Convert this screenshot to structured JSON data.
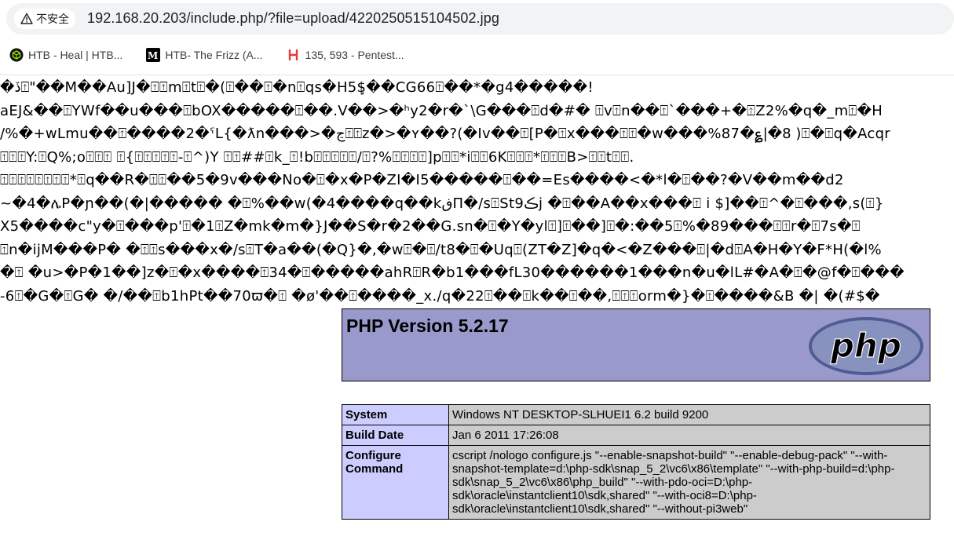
{
  "browser": {
    "security_label": "不安全",
    "url": "192.168.20.203/include.php/?file=upload/4220250515104502.jpg",
    "bookmarks": [
      {
        "label": "HTB - Heal | HTB..."
      },
      {
        "label": "HTB- The Frizz (A..."
      },
      {
        "label": "135, 593 - Pentest..."
      }
    ]
  },
  "garbage_lines": [
    "�ڏ⍐\"��M��Au]J�⍐⍐m⍐t⍐�(⍐��⍐�n⍐qs�H5$̧��CG66⍐��*�g4�����!",
    "aEJ&��⍐YWf��u���⍐bOX�����⍐��.V��>�ʰy2�r�`\\G���⍐d�#� ⍐v⍐n��⍐`���+�⍐Z2%�q�_m⍐�H",
    "/%�+wLmu��⍐����2�ˁL{�ƛn���>�ڃ⍐⍐z�>�ʏ��?(�Iv��⍐[P�⍐x���⍐⍐�w���%87�؏|�8 )⍐�⍐q�Acqr",
    "⍐⍐⍐Y:⍐Q%;o⍐⍐⍐ ⍐{⍐⍐⍐⍐⍐-⍐^)Y ⍐⍐##⍐k_⍐!b⍐⍐⍐⍐⍐/⍐?%⍐⍐⍐⍐]p⍐⍐*i⍐⍐6K⍐⍐⍐*⍐⍐⍐B>⍐⍐t⍐⍐.",
    "⍐⍐⍐⍐⍐⍐⍐⍐*⍐q��R�⍐⍐��5�9v���No�⍐�x�P�ZI�I5�����⍐��=Es����<�*l�⍐��?�V��m��d2",
    "~�4�ሌP�ɲ��(�|����� �⍐%��w(�4����q��kڧΠ�/s⍐St9ڪj �⍐��A��x���⍐ i $]��⍐^�⍐���,s(⍐}",
    "X5����c\"y�⍐���p'⍐�1⍐Z�mk�m�}J��S�r�2��G.sn�⍐�Y�yl⍐]⍐��]⍐�:��5⍐%�89���⍐⍐r�⍐7s�⍐",
    "⍐n�ijM���P� �⍐⍐s���x�/s⍐T�a��(�Q}�,�w⍐�⍐/t8�⍐�Uq⍐(ZT�Z]�q�<�Z���⍐|�d⍐A�H�Y�F*H(�l%",
    "�⍐ �u>�P�1��]z�⍐�x����⍐34�⍐�����ahR⍐R�b1���fL30������1���n�u�lL#�A�⍐�@f�⍐���",
    "-6⍐�G�⍐G� �/��⍐b1hPt��70ϖ�⍐ �ø'��⍐����_x./q�22⍐��⍐k��⍐��,⍐⍐⍐orm�}�⍐����&B �| �(#$�"
  ],
  "phpinfo": {
    "title": "PHP Version 5.2.17",
    "logo_text": "php",
    "rows": [
      {
        "key": "System",
        "value": "Windows NT DESKTOP-SLHUEI1 6.2 build 9200"
      },
      {
        "key": "Build Date",
        "value": "Jan 6 2011 17:26:08"
      },
      {
        "key": "Configure Command",
        "value": "cscript /nologo configure.js \"--enable-snapshot-build\" \"--enable-debug-pack\" \"--with-snapshot-template=d:\\php-sdk\\snap_5_2\\vc6\\x86\\template\" \"--with-php-build=d:\\php-sdk\\snap_5_2\\vc6\\x86\\php_build\" \"--with-pdo-oci=D:\\php-sdk\\oracle\\instantclient10\\sdk,shared\" \"--with-oci8=D:\\php-sdk\\oracle\\instantclient10\\sdk,shared\" \"--without-pi3web\""
      }
    ]
  },
  "colors": {
    "php_header_bg": "#9999cc",
    "php_key_bg": "#ccccff",
    "php_value_bg": "#cccccc"
  }
}
